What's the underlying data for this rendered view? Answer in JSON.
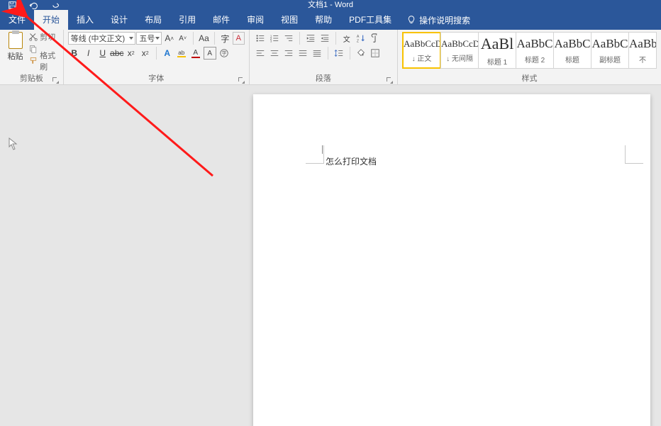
{
  "window": {
    "title": "文档1 - Word"
  },
  "tabs": {
    "file": "文件",
    "home": "开始",
    "insert": "插入",
    "design": "设计",
    "layout": "布局",
    "references": "引用",
    "mailings": "邮件",
    "review": "审阅",
    "view": "视图",
    "help": "帮助",
    "pdf": "PDF工具集",
    "tellme": "操作说明搜索"
  },
  "ribbon": {
    "clipboard": {
      "paste": "粘贴",
      "cut": "剪切",
      "copy": "复制",
      "format_painter": "格式刷",
      "group": "剪贴板"
    },
    "font": {
      "family": "等线 (中文正文)",
      "size": "五号",
      "group": "字体"
    },
    "paragraph": {
      "group": "段落"
    },
    "styles": {
      "group": "样式",
      "items": [
        {
          "sample": "AaBbCcDc",
          "name": "↓ 正文"
        },
        {
          "sample": "AaBbCcDc",
          "name": "↓ 无间隔"
        },
        {
          "sample": "AaBl",
          "name": "标题 1"
        },
        {
          "sample": "AaBbC",
          "name": "标题 2"
        },
        {
          "sample": "AaBbC",
          "name": "标题"
        },
        {
          "sample": "AaBbC",
          "name": "副标题"
        },
        {
          "sample": "AaBbC",
          "name": "不"
        }
      ]
    }
  },
  "document": {
    "text": "怎么打印文档"
  }
}
